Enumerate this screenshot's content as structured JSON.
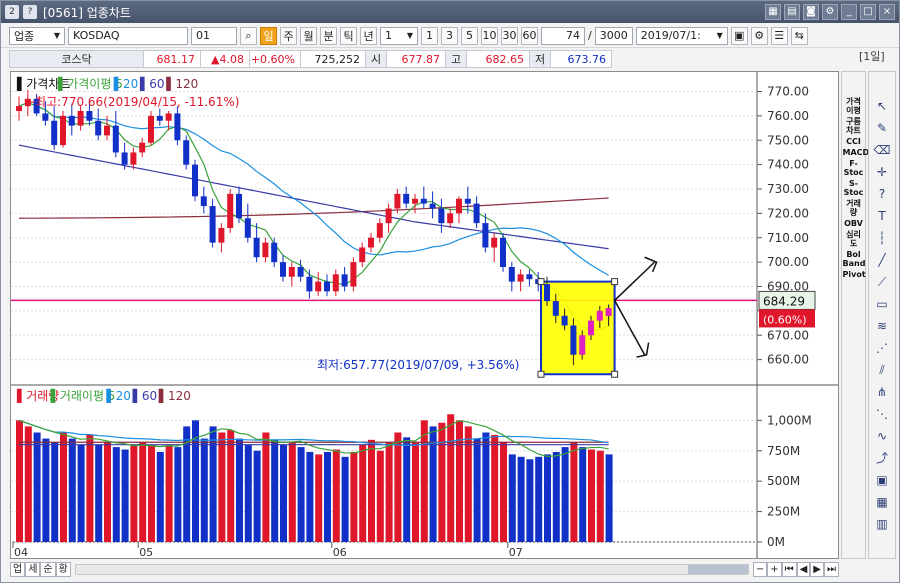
{
  "window": {
    "title": "[0561] 업종차트",
    "code": "2"
  },
  "toolbar": {
    "mode": "업종",
    "market": "KOSDAQ",
    "code": "01",
    "periods": [
      "일",
      "주",
      "월",
      "분",
      "틱",
      "년"
    ],
    "active_period": "일",
    "interval": "1",
    "interval_buttons": [
      "1",
      "3",
      "5",
      "10",
      "30",
      "60"
    ],
    "count_a": "74",
    "count_b": "3000",
    "date": "2019/07/1:",
    "period_badge": "[1일]"
  },
  "quote": {
    "name": "코스닥",
    "price": "681.17",
    "change": "▲4.08",
    "change_pct": "+0.60%",
    "volume": "725,252",
    "open_label": "시",
    "open": "677.87",
    "high_label": "고",
    "high": "682.65",
    "low_label": "저",
    "low": "673.76"
  },
  "price_panel": {
    "title": "가격차트",
    "ma_label": "가격이평 5",
    "ma_values": [
      "20",
      "60",
      "120"
    ],
    "high_note": "←최고:770.66(2019/04/15, -11.61%)",
    "low_note": "최저:657.77(2019/07/09, +3.56%)",
    "crosshair_value": "684.29",
    "current_change": "(0.60%)",
    "y_ticks": [
      "770.00",
      "760.00",
      "750.00",
      "740.00",
      "730.00",
      "720.00",
      "710.00",
      "700.00",
      "690.00",
      "680.00",
      "670.00",
      "660.00"
    ]
  },
  "volume_panel": {
    "title": "거래량",
    "ma_label": "거래이평 5",
    "ma_values": [
      "20",
      "60",
      "120"
    ],
    "y_ticks": [
      "1,000M",
      "750M",
      "500M",
      "250M",
      "0M"
    ]
  },
  "x_axis": [
    "04",
    "05",
    "06",
    "07"
  ],
  "bottom_tabs": [
    "업",
    "세",
    "순",
    "황"
  ],
  "sidebar_indicators": [
    "가격이평",
    "구름차트",
    "CCI",
    "MACD",
    "F-Stoc",
    "S-Stoc",
    "거래량",
    "OBV",
    "심리도",
    "Bol Band",
    "Pivot"
  ],
  "colors": {
    "up": "#e0162b",
    "down": "#1030c8",
    "ma5": "#3aa33a",
    "ma20": "#1b8fe0",
    "ma60": "#3b3ba8",
    "ma120": "#8b2e3e",
    "crosshair": "#e0127a",
    "highlight": "#ffff00"
  },
  "chart_data": {
    "type": "candlestick",
    "price_candles": [
      [
        762,
        768,
        758,
        764
      ],
      [
        764,
        770.66,
        760,
        767
      ],
      [
        767,
        769,
        760,
        761
      ],
      [
        761,
        766,
        756,
        758
      ],
      [
        758,
        764,
        746,
        748
      ],
      [
        748,
        762,
        747,
        760
      ],
      [
        760,
        765,
        752,
        756
      ],
      [
        756,
        764,
        754,
        762
      ],
      [
        762,
        766,
        756,
        758
      ],
      [
        758,
        763,
        750,
        752
      ],
      [
        752,
        760,
        750,
        756
      ],
      [
        756,
        762,
        743,
        745
      ],
      [
        745,
        749,
        738,
        740
      ],
      [
        740,
        747,
        738,
        745
      ],
      [
        745,
        751,
        743,
        749
      ],
      [
        749,
        762,
        748,
        760
      ],
      [
        760,
        763,
        756,
        758
      ],
      [
        758,
        762,
        754,
        761
      ],
      [
        761,
        764,
        748,
        750
      ],
      [
        750,
        752,
        738,
        740
      ],
      [
        740,
        742,
        725,
        727
      ],
      [
        727,
        731,
        720,
        723
      ],
      [
        723,
        726,
        706,
        708
      ],
      [
        708,
        716,
        704,
        714
      ],
      [
        714,
        730,
        712,
        728
      ],
      [
        728,
        731,
        716,
        718
      ],
      [
        718,
        724,
        708,
        710
      ],
      [
        710,
        716,
        700,
        702
      ],
      [
        702,
        710,
        700,
        708
      ],
      [
        708,
        710,
        698,
        700
      ],
      [
        700,
        703,
        692,
        694
      ],
      [
        694,
        700,
        690,
        698
      ],
      [
        698,
        701,
        692,
        694
      ],
      [
        694,
        697,
        685,
        688
      ],
      [
        688,
        696,
        686,
        692
      ],
      [
        692,
        695,
        686,
        688
      ],
      [
        688,
        697,
        686,
        695
      ],
      [
        695,
        698,
        688,
        690
      ],
      [
        690,
        702,
        688,
        700
      ],
      [
        700,
        708,
        698,
        706
      ],
      [
        706,
        712,
        704,
        710
      ],
      [
        710,
        718,
        708,
        716
      ],
      [
        716,
        724,
        712,
        722
      ],
      [
        722,
        730,
        720,
        728
      ],
      [
        728,
        731,
        722,
        724
      ],
      [
        724,
        728,
        720,
        726
      ],
      [
        726,
        731,
        722,
        724
      ],
      [
        724,
        729,
        718,
        722
      ],
      [
        722,
        726,
        712,
        716
      ],
      [
        716,
        722,
        714,
        720
      ],
      [
        720,
        727,
        716,
        726
      ],
      [
        726,
        731,
        720,
        724
      ],
      [
        724,
        727,
        714,
        716
      ],
      [
        716,
        720,
        704,
        706
      ],
      [
        706,
        712,
        700,
        710
      ],
      [
        710,
        712,
        696,
        698
      ],
      [
        698,
        700,
        688,
        692
      ],
      [
        692,
        697,
        688,
        695
      ],
      [
        695,
        697,
        690,
        693
      ],
      [
        693,
        696,
        688,
        691
      ],
      [
        691,
        694,
        682,
        684
      ],
      [
        684,
        687,
        675,
        678
      ],
      [
        678,
        681,
        672,
        674
      ],
      [
        674,
        677,
        657.77,
        662
      ],
      [
        662,
        672,
        660,
        670
      ],
      [
        670,
        678,
        668,
        676
      ],
      [
        676,
        682,
        673,
        680
      ],
      [
        677.87,
        682.65,
        673.76,
        681.17
      ]
    ],
    "volume": [
      [
        1.0,
        "up"
      ],
      [
        0.95,
        "up"
      ],
      [
        0.9,
        "down"
      ],
      [
        0.85,
        "down"
      ],
      [
        0.82,
        "down"
      ],
      [
        0.9,
        "up"
      ],
      [
        0.85,
        "down"
      ],
      [
        0.8,
        "down"
      ],
      [
        0.88,
        "up"
      ],
      [
        0.8,
        "down"
      ],
      [
        0.82,
        "up"
      ],
      [
        0.78,
        "down"
      ],
      [
        0.76,
        "down"
      ],
      [
        0.8,
        "up"
      ],
      [
        0.82,
        "up"
      ],
      [
        0.8,
        "up"
      ],
      [
        0.74,
        "down"
      ],
      [
        0.8,
        "up"
      ],
      [
        0.78,
        "down"
      ],
      [
        0.95,
        "down"
      ],
      [
        1.0,
        "down"
      ],
      [
        0.85,
        "down"
      ],
      [
        0.95,
        "down"
      ],
      [
        0.9,
        "up"
      ],
      [
        0.92,
        "up"
      ],
      [
        0.85,
        "down"
      ],
      [
        0.8,
        "down"
      ],
      [
        0.75,
        "down"
      ],
      [
        0.9,
        "up"
      ],
      [
        0.84,
        "down"
      ],
      [
        0.8,
        "down"
      ],
      [
        0.82,
        "up"
      ],
      [
        0.78,
        "down"
      ],
      [
        0.74,
        "down"
      ],
      [
        0.72,
        "up"
      ],
      [
        0.74,
        "down"
      ],
      [
        0.76,
        "up"
      ],
      [
        0.7,
        "down"
      ],
      [
        0.74,
        "up"
      ],
      [
        0.8,
        "up"
      ],
      [
        0.84,
        "up"
      ],
      [
        0.75,
        "up"
      ],
      [
        0.82,
        "up"
      ],
      [
        0.9,
        "up"
      ],
      [
        0.86,
        "down"
      ],
      [
        0.82,
        "up"
      ],
      [
        1.0,
        "up"
      ],
      [
        0.95,
        "down"
      ],
      [
        0.98,
        "up"
      ],
      [
        1.05,
        "up"
      ],
      [
        1.0,
        "up"
      ],
      [
        0.95,
        "up"
      ],
      [
        0.85,
        "down"
      ],
      [
        0.9,
        "down"
      ],
      [
        0.88,
        "up"
      ],
      [
        0.82,
        "up"
      ],
      [
        0.72,
        "down"
      ],
      [
        0.7,
        "down"
      ],
      [
        0.68,
        "down"
      ],
      [
        0.7,
        "down"
      ],
      [
        0.72,
        "down"
      ],
      [
        0.74,
        "down"
      ],
      [
        0.78,
        "down"
      ],
      [
        0.82,
        "up"
      ],
      [
        0.78,
        "down"
      ],
      [
        0.76,
        "up"
      ],
      [
        0.75,
        "up"
      ],
      [
        0.72,
        "down"
      ]
    ]
  }
}
